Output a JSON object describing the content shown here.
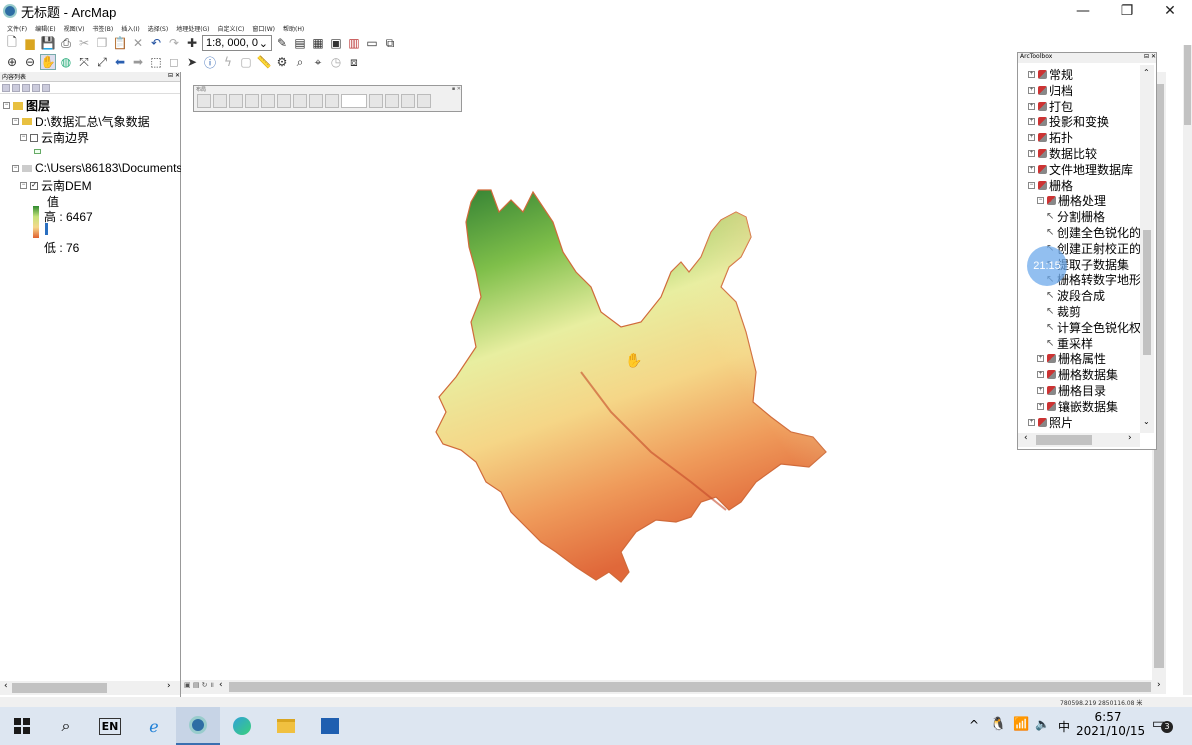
{
  "window": {
    "title": "无标题 - ArcMap",
    "minimize": "—",
    "maximize": "❐",
    "close": "✕"
  },
  "menu": [
    "文件(F)",
    "编辑(E)",
    "视图(V)",
    "书签(B)",
    "插入(I)",
    "选择(S)",
    "地理处理(G)",
    "自定义(C)",
    "窗口(W)",
    "帮助(H)"
  ],
  "toolbar": {
    "scale_value": "1:8, 000, 0",
    "scale_arrow": "⌄"
  },
  "toc": {
    "header": "内容列表",
    "root_label": "图层",
    "group1_path": "D:\\数据汇总\\气象数据",
    "layer1_name": "云南边界",
    "group2_path": "C:\\Users\\86183\\Documents\\",
    "layer2_name": "云南DEM",
    "legend_value_label": "值",
    "legend_high": "高 : 6467",
    "legend_low": "低 : 76"
  },
  "layout_toolbar": {
    "caption": "布局"
  },
  "map": {
    "status_coords": "780598.219  2850116.08 米",
    "overlay_time": "21:15"
  },
  "arctoolbox": {
    "caption": "ArcToolbox",
    "items": [
      {
        "label": "常规",
        "level": 0,
        "kind": "toolbox",
        "expander": "+"
      },
      {
        "label": "归档",
        "level": 0,
        "kind": "toolbox",
        "expander": "+"
      },
      {
        "label": "打包",
        "level": 0,
        "kind": "toolbox",
        "expander": "+"
      },
      {
        "label": "投影和变换",
        "level": 0,
        "kind": "toolbox",
        "expander": "+"
      },
      {
        "label": "拓扑",
        "level": 0,
        "kind": "toolbox",
        "expander": "+"
      },
      {
        "label": "数据比较",
        "level": 0,
        "kind": "toolbox",
        "expander": "+"
      },
      {
        "label": "文件地理数据库",
        "level": 0,
        "kind": "toolbox",
        "expander": "+"
      },
      {
        "label": "栅格",
        "level": 0,
        "kind": "toolbox",
        "expander": "−"
      },
      {
        "label": "栅格处理",
        "level": 1,
        "kind": "toolbox",
        "expander": "−"
      },
      {
        "label": "分割栅格",
        "level": 2,
        "kind": "tool"
      },
      {
        "label": "创建全色锐化的",
        "level": 2,
        "kind": "tool"
      },
      {
        "label": "创建正射校正的",
        "level": 2,
        "kind": "tool"
      },
      {
        "label": "提取子数据集",
        "level": 2,
        "kind": "tool"
      },
      {
        "label": "栅格转数字地形",
        "level": 2,
        "kind": "tool"
      },
      {
        "label": "波段合成",
        "level": 2,
        "kind": "tool"
      },
      {
        "label": "裁剪",
        "level": 2,
        "kind": "tool"
      },
      {
        "label": "计算全色锐化权",
        "level": 2,
        "kind": "tool"
      },
      {
        "label": "重采样",
        "level": 2,
        "kind": "tool"
      },
      {
        "label": "栅格属性",
        "level": 1,
        "kind": "toolbox",
        "expander": "+"
      },
      {
        "label": "栅格数据集",
        "level": 1,
        "kind": "toolbox",
        "expander": "+"
      },
      {
        "label": "栅格目录",
        "level": 1,
        "kind": "toolbox",
        "expander": "+"
      },
      {
        "label": "镶嵌数据集",
        "level": 1,
        "kind": "toolbox",
        "expander": "+"
      },
      {
        "label": "照片",
        "level": 0,
        "kind": "toolbox",
        "expander": "+"
      }
    ]
  },
  "taskbar": {
    "lang_indicator": "EN",
    "ime": "中",
    "time": "6:57",
    "date": "2021/10/15",
    "notifications": "3"
  }
}
